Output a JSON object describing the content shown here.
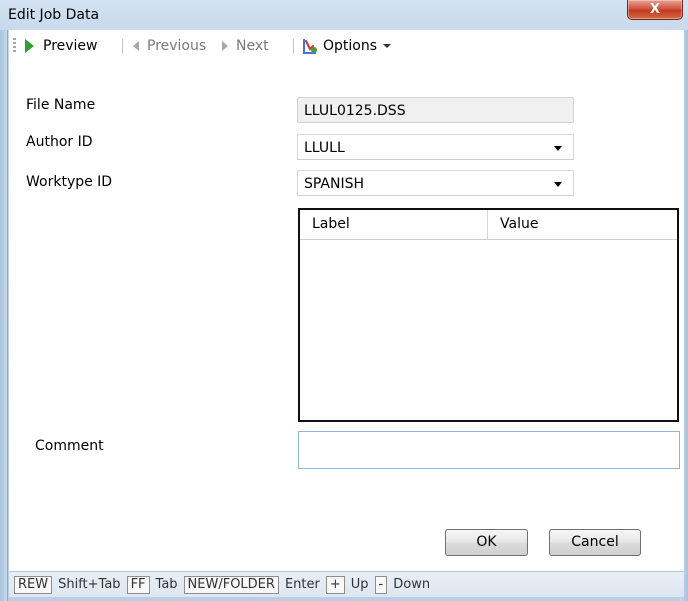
{
  "window": {
    "title": "Edit Job Data",
    "close_glyph": "X"
  },
  "toolbar": {
    "preview_label": "Preview",
    "previous_label": "Previous",
    "next_label": "Next",
    "options_label": "Options"
  },
  "form": {
    "file_name_label": "File Name",
    "file_name_value": "LLUL0125.DSS",
    "author_id_label": "Author ID",
    "author_id_value": "LLULL",
    "worktype_id_label": "Worktype ID",
    "worktype_id_value": "SPANISH",
    "comment_label": "Comment",
    "comment_value": ""
  },
  "grid": {
    "columns": [
      "Label",
      "Value"
    ],
    "rows": []
  },
  "buttons": {
    "ok_label": "OK",
    "cancel_label": "Cancel"
  },
  "status_bar": {
    "shortcuts": [
      {
        "key": "REW",
        "action": "Shift+Tab"
      },
      {
        "key": "FF",
        "action": "Tab"
      },
      {
        "key": "NEW/FOLDER",
        "action": "Enter"
      },
      {
        "key": "+",
        "action": "Up"
      },
      {
        "key": "-",
        "action": "Down"
      }
    ]
  },
  "colors": {
    "preview_icon": "#2e9e2e",
    "close_button": "#c23a20",
    "frame": "#b9cde3"
  }
}
